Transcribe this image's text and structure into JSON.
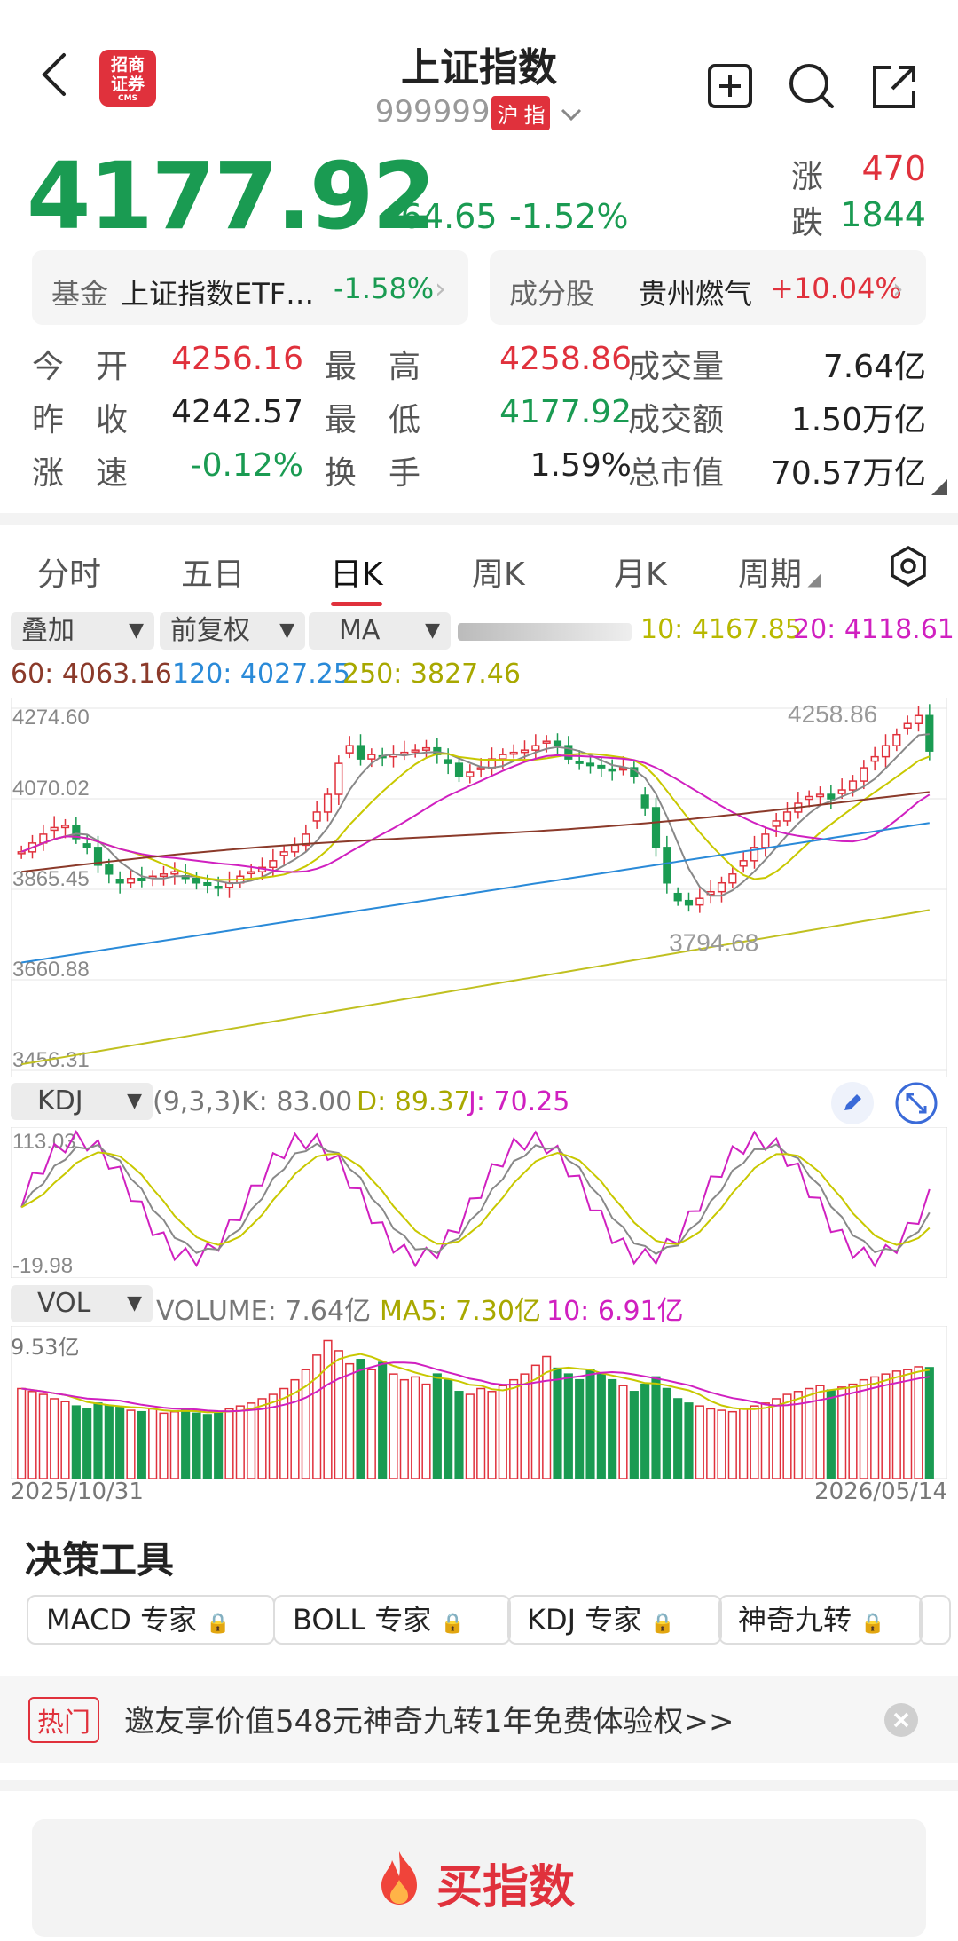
{
  "header": {
    "title": "上证指数",
    "code": "999999",
    "market_tag1": "沪",
    "market_tag2": "指",
    "logo_line1": "招商",
    "logo_line2": "证券",
    "logo_sub": "CMS"
  },
  "quote": {
    "price": "4177.92",
    "change": "-64.65",
    "change_pct": "-1.52%",
    "up_label": "涨",
    "up_count": "470",
    "down_label": "跌",
    "down_count": "1844"
  },
  "related": {
    "fund_label": "基金",
    "fund_name": "上证指数ETF…",
    "fund_pct": "-1.58%",
    "comp_label": "成分股",
    "comp_name": "贵州燃气",
    "comp_pct": "+10.04%"
  },
  "stats": [
    [
      {
        "label": "今　开",
        "value": "4256.16",
        "color": "red"
      },
      {
        "label": "最　高",
        "value": "4258.86",
        "color": "red"
      },
      {
        "label": "成交量",
        "value": "7.64亿",
        "color": "dark"
      }
    ],
    [
      {
        "label": "昨　收",
        "value": "4242.57",
        "color": "dark"
      },
      {
        "label": "最　低",
        "value": "4177.92",
        "color": "green"
      },
      {
        "label": "成交额",
        "value": "1.50万亿",
        "color": "dark"
      }
    ],
    [
      {
        "label": "涨　速",
        "value": "-0.12%",
        "color": "green"
      },
      {
        "label": "换　手",
        "value": "1.59%",
        "color": "dark"
      },
      {
        "label": "总市值",
        "value": "70.57万亿",
        "color": "dark"
      }
    ]
  ],
  "tabs": [
    "分时",
    "五日",
    "日K",
    "周K",
    "月K",
    "周期"
  ],
  "active_tab": "日K",
  "toolbar": {
    "overlay": "叠加",
    "adjust": "前复权",
    "indicator": "MA",
    "ma10": "10: 4167.85",
    "ma20": "20: 4118.61",
    "ma60": "60: 4063.16",
    "ma120": "120: 4027.25",
    "ma250": "250: 3827.46"
  },
  "colors": {
    "up": "#e0313c",
    "down": "#1a9b52",
    "ma5": "#888888",
    "ma10": "#c8c800",
    "ma20": "#d020c0",
    "ma60": "#8b3a2a",
    "ma120": "#2a8ad8",
    "ma250": "#c0c020"
  },
  "kdj": {
    "label": "KDJ",
    "params": "(9,3,3)",
    "k": "K: 83.00",
    "d": "D: 89.37",
    "j": "J: 70.25"
  },
  "vol": {
    "label": "VOL",
    "volume": "VOLUME: 7.64亿",
    "ma5": "MA5: 7.30亿",
    "ma10": "10: 6.91亿",
    "max": "9.53亿"
  },
  "dates": {
    "start": "2025/10/31",
    "end": "2026/05/14"
  },
  "chart_data": {
    "type": "candlestick",
    "y_ticks": [
      "4274.60",
      "4070.02",
      "3865.45",
      "3660.88",
      "3456.31"
    ],
    "ylim": [
      3456.31,
      4274.6
    ],
    "high_label": "4258.86",
    "low_label": "3794.68",
    "kdj_ticks": [
      "113.03",
      "-19.98"
    ],
    "closes": [
      3950,
      3970,
      3990,
      4005,
      4010,
      3980,
      3960,
      3920,
      3900,
      3880,
      3890,
      3885,
      3895,
      3900,
      3905,
      3890,
      3880,
      3875,
      3870,
      3880,
      3895,
      3905,
      3915,
      3930,
      3950,
      3965,
      3990,
      4040,
      4080,
      4150,
      4190,
      4160,
      4170,
      4165,
      4170,
      4175,
      4180,
      4185,
      4170,
      4150,
      4120,
      4130,
      4140,
      4160,
      4170,
      4175,
      4180,
      4190,
      4200,
      4190,
      4160,
      4150,
      4145,
      4140,
      4135,
      4140,
      4120,
      4050,
      3960,
      3880,
      3840,
      3830,
      3845,
      3860,
      3880,
      3900,
      3930,
      3960,
      3990,
      4020,
      4040,
      4060,
      4075,
      4080,
      4070,
      4090,
      4110,
      4140,
      4165,
      4190,
      4215,
      4240,
      4258,
      4178
    ],
    "volumes": [
      6.2,
      6.0,
      5.8,
      5.5,
      5.3,
      5.0,
      4.8,
      5.2,
      5.0,
      4.9,
      4.7,
      4.6,
      4.8,
      4.5,
      4.6,
      4.8,
      4.5,
      4.4,
      4.6,
      4.8,
      5.0,
      5.2,
      5.5,
      5.8,
      6.2,
      6.8,
      7.5,
      8.5,
      9.5,
      8.8,
      7.9,
      8.2,
      7.5,
      8.0,
      7.2,
      6.8,
      7.0,
      6.5,
      7.2,
      6.8,
      6.0,
      5.8,
      6.2,
      6.0,
      6.4,
      6.8,
      7.2,
      7.8,
      8.4,
      7.6,
      7.2,
      6.8,
      7.5,
      7.2,
      6.8,
      6.4,
      6.0,
      6.5,
      7.0,
      6.2,
      5.5,
      5.2,
      5.0,
      4.8,
      4.7,
      4.6,
      4.8,
      5.0,
      5.2,
      5.5,
      5.8,
      6.0,
      6.2,
      6.4,
      6.1,
      6.3,
      6.5,
      6.8,
      7.0,
      7.2,
      7.4,
      7.5,
      7.7,
      7.64
    ]
  },
  "tools": {
    "title": "决策工具",
    "chips": [
      "MACD 专家",
      "BOLL 专家",
      "KDJ 专家",
      "神奇九转"
    ]
  },
  "promo": {
    "tag": "热门",
    "text": "邀友享价值548元神奇九转1年免费体验权>>"
  },
  "buy_button": "买指数"
}
